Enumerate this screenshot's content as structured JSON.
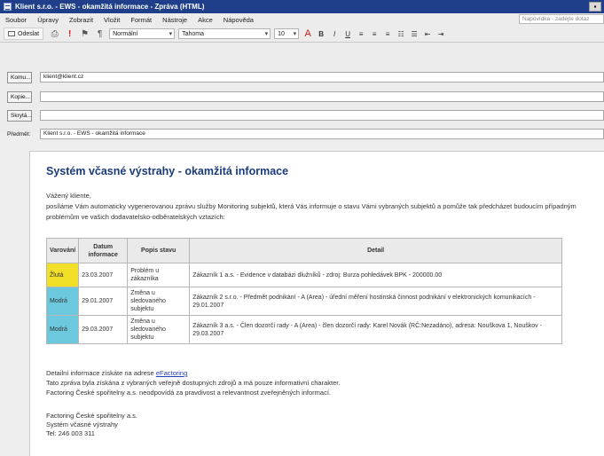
{
  "window": {
    "title": "Klient s.r.o. - EWS - okamžitá informace - Zpráva (HTML)",
    "titlebar_color": "#1f3f8a"
  },
  "menu": {
    "items": [
      "Soubor",
      "Úpravy",
      "Zobrazit",
      "Vložit",
      "Formát",
      "Nástroje",
      "Akce",
      "Nápověda"
    ],
    "help_placeholder": "Napovídka - zadejte dotaz"
  },
  "toolbar": {
    "send_label": "Odeslat",
    "style_value": "Normální",
    "font_value": "Tahoma",
    "size_value": "10",
    "format_buttons": [
      "B",
      "I",
      "U"
    ]
  },
  "header": {
    "to_label": "Komu...",
    "to_value": "klient@klient.cz",
    "cc_label": "Kopie...",
    "cc_value": "",
    "bcc_label": "Skrytá...",
    "bcc_value": "",
    "subject_label": "Předmět:",
    "subject_value": "Klient s.r.o. - EWS - okamžitá informace"
  },
  "message": {
    "heading": "Systém včasné výstrahy - okamžitá informace",
    "greeting": "Vážený kliente,",
    "intro": "posíláme Vám automaticky vygenerovanou zprávu služby Monitoring subjektů, která Vás informuje o stavu Vámi vybraných subjektů a pomůže tak předcházet budoucím případným problémům ve vašich dodavatelsko-odběratelských vztazích:",
    "table": {
      "headers": [
        "Varování",
        "Datum informace",
        "Popis stavu",
        "Detail"
      ],
      "rows": [
        {
          "level": "Žlutá",
          "level_color": "#f2df27",
          "date": "23.03.2007",
          "state": "Problém u zákazníka",
          "detail": "Zákazník 1 a.s. - Evidence v databázi dlužníků - zdroj: Burza pohledávek BPK - 200000.00"
        },
        {
          "level": "Modrá",
          "level_color": "#6cc8dd",
          "date": "29.01.2007",
          "state": "Změna u sledovaného subjektu",
          "detail": "Zákazník 2 s.r.o. - Předmět podnikání - A (Area) - úřední měření hostinská činnost podnikání v elektronických komunikacích - 29.01.2007"
        },
        {
          "level": "Modrá",
          "level_color": "#6cc8dd",
          "date": "29.03.2007",
          "state": "Změna u sledovaného subjektu",
          "detail": "Zákazník 3 a.s. - Člen dozorčí rady - A (Area) - člen dozorčí rady: Karel Novák (RČ:Nezadáno), adresa: Nouškova 1, Nouškov - 29.03.2007"
        }
      ]
    },
    "footer_prefix": "Detailní informace získáte na adrese",
    "footer_link": "eFactoring",
    "footer_line2": "Tato zpráva byla získána z vybraných veřejně dostupných zdrojů a má pouze informativní charakter.",
    "footer_line3": "Factoring České spořitelny a.s. neodpovídá za pravdivost a relevantnost zveřejněných informací.",
    "signature": [
      "Factoring České spořitelny a.s.",
      "Systém včasné výstrahy",
      "Tel: 246 003 311"
    ]
  }
}
